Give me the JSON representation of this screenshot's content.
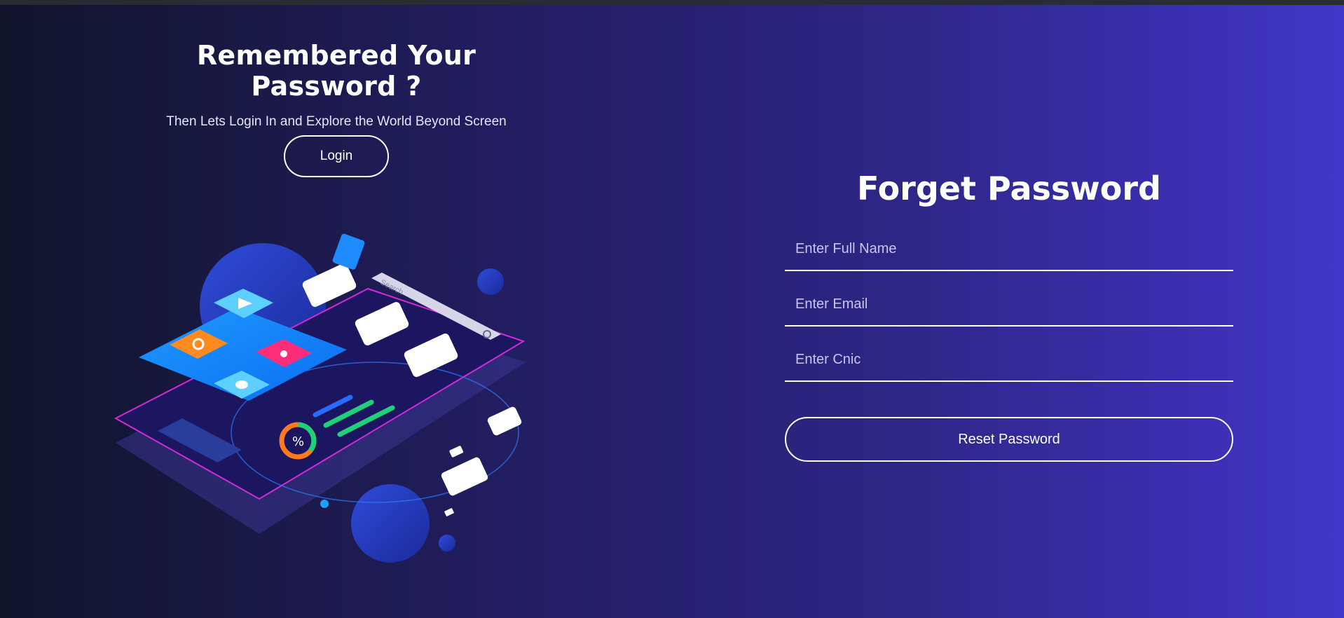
{
  "left": {
    "heading": "Remembered Your Password ?",
    "subheading": "Then Lets Login In and Explore the World Beyond Screen",
    "login_label": "Login"
  },
  "illustration": {
    "search_placeholder": "Search"
  },
  "form": {
    "title": "Forget Password",
    "full_name_placeholder": "Enter Full Name",
    "email_placeholder": "Enter Email",
    "cnic_placeholder": "Enter Cnic",
    "reset_label": "Reset Password"
  },
  "colors": {
    "background_start": "#10142a",
    "background_end": "#4236c8",
    "text": "#ffffff"
  }
}
